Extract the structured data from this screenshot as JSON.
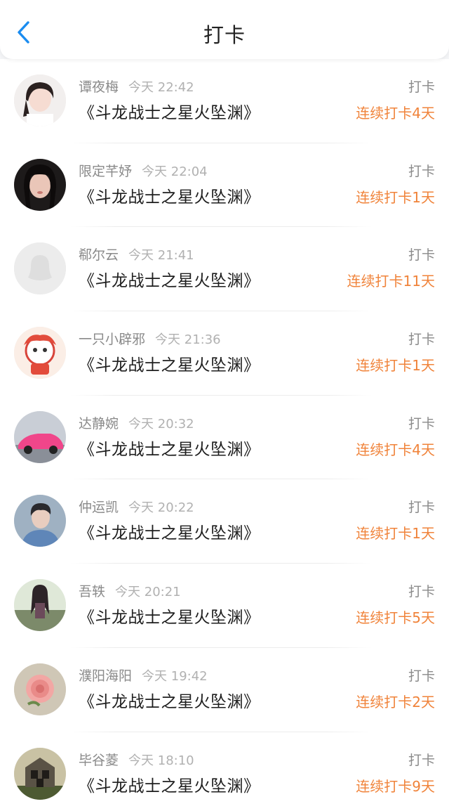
{
  "header": {
    "title": "打卡",
    "back_icon": "chevron-left-icon",
    "accent": "#1a8cf0"
  },
  "colors": {
    "streak": "#f0833a",
    "muted": "#8a8a8a"
  },
  "items": [
    {
      "name": "谭夜梅",
      "time": "今天 22:42",
      "book": "《斗龙战士之星火坠渊》",
      "tag": "打卡",
      "streak": "连续打卡4天",
      "avatar": "girl-portrait"
    },
    {
      "name": "限定芊妤",
      "time": "今天 22:04",
      "book": "《斗龙战士之星火坠渊》",
      "tag": "打卡",
      "streak": "连续打卡1天",
      "avatar": "girl-dark-hair"
    },
    {
      "name": "郗尔云",
      "time": "今天 21:41",
      "book": "《斗龙战士之星火坠渊》",
      "tag": "打卡",
      "streak": "连续打卡11天",
      "avatar": "default-penguin"
    },
    {
      "name": "一只小辟邪",
      "time": "今天 21:36",
      "book": "《斗龙战士之星火坠渊》",
      "tag": "打卡",
      "streak": "连续打卡1天",
      "avatar": "cartoon-lion"
    },
    {
      "name": "达静婉",
      "time": "今天 20:32",
      "book": "《斗龙战士之星火坠渊》",
      "tag": "打卡",
      "streak": "连续打卡4天",
      "avatar": "pink-car"
    },
    {
      "name": "仲运凯",
      "time": "今天 20:22",
      "book": "《斗龙战士之星火坠渊》",
      "tag": "打卡",
      "streak": "连续打卡1天",
      "avatar": "boy-portrait"
    },
    {
      "name": "吾轶",
      "time": "今天 20:21",
      "book": "《斗龙战士之星火坠渊》",
      "tag": "打卡",
      "streak": "连续打卡5天",
      "avatar": "anime-girl"
    },
    {
      "name": "濮阳海阳",
      "time": "今天 19:42",
      "book": "《斗龙战士之星火坠渊》",
      "tag": "打卡",
      "streak": "连续打卡2天",
      "avatar": "pink-rose"
    },
    {
      "name": "毕谷菱",
      "time": "今天 18:10",
      "book": "《斗龙战士之星火坠渊》",
      "tag": "打卡",
      "streak": "连续打卡9天",
      "avatar": "ruined-house"
    }
  ]
}
